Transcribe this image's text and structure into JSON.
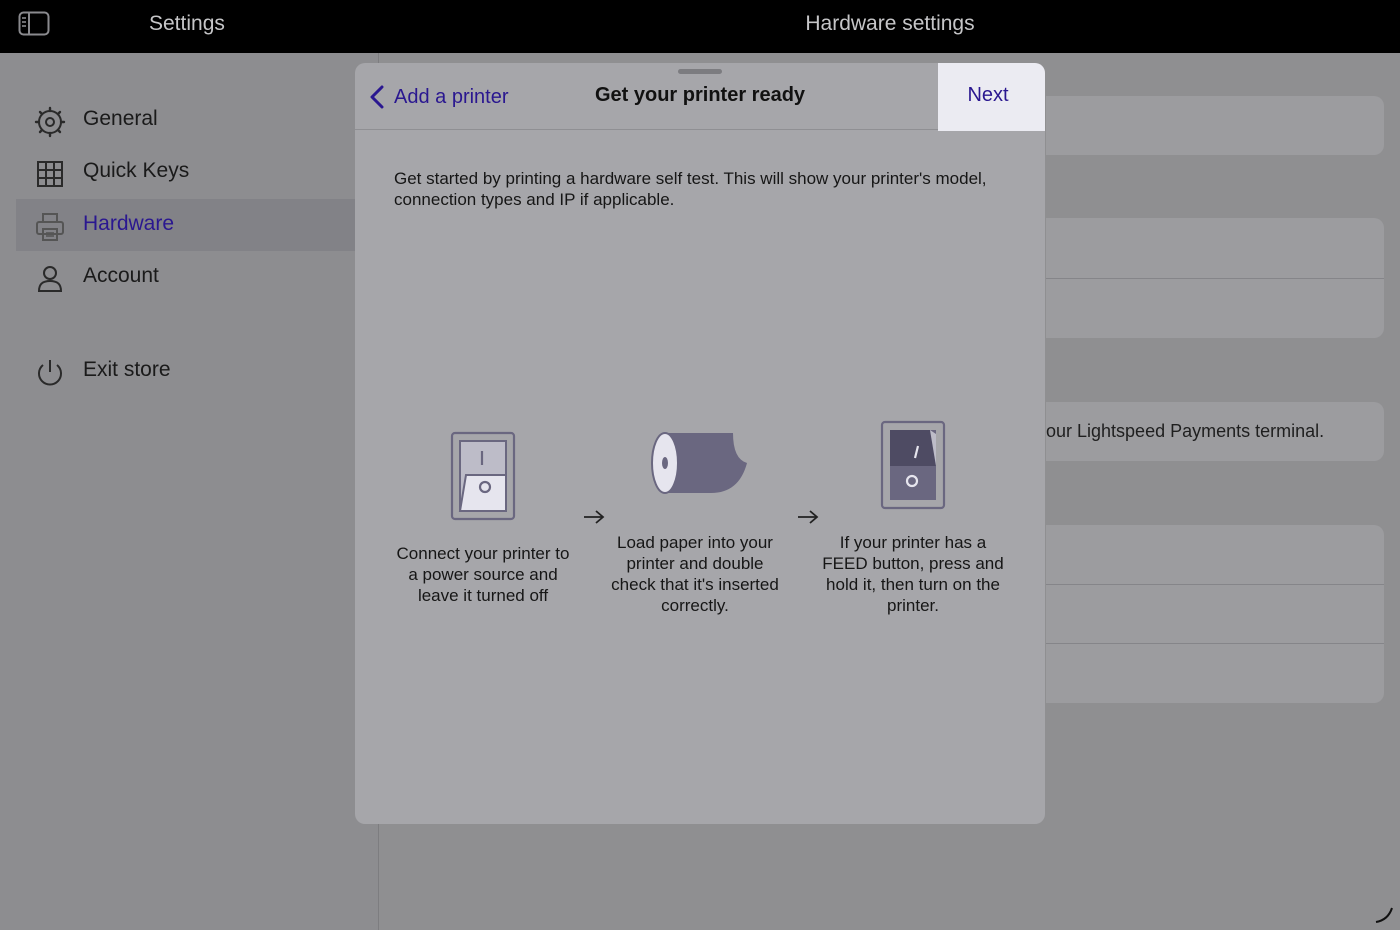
{
  "topbar": {
    "left_title": "Settings",
    "right_title": "Hardware settings",
    "toggle_icon": "sidebar-toggle-icon"
  },
  "sidebar": {
    "items": [
      {
        "label": "General",
        "icon": "gear-icon",
        "selected": false
      },
      {
        "label": "Quick Keys",
        "icon": "grid-icon",
        "selected": false
      },
      {
        "label": "Hardware",
        "icon": "printer-icon",
        "selected": true
      },
      {
        "label": "Account",
        "icon": "person-icon",
        "selected": false
      },
      {
        "label": "Exit store",
        "icon": "power-icon",
        "selected": false
      }
    ]
  },
  "background": {
    "payments_text": "our Lightspeed Payments terminal."
  },
  "modal": {
    "back_label": "Add a printer",
    "title": "Get your printer ready",
    "next_label": "Next",
    "intro": "Get started by printing a hardware self test. This will show your printer's model, connection types and IP if applicable.",
    "steps": [
      {
        "text": "Connect your printer to a power source and leave it turned off",
        "icon": "power-switch-off-icon"
      },
      {
        "text": "Load paper into your printer and double check that it's inserted correctly.",
        "icon": "paper-roll-icon"
      },
      {
        "text": "If your printer has a FEED button, press and hold it, then turn on the printer.",
        "icon": "power-switch-on-icon"
      }
    ]
  },
  "colors": {
    "accent": "#2a1790",
    "overlay": "#8f8f91",
    "modal_bg": "#a6a6aa",
    "icon_fill": "#6a6780"
  }
}
